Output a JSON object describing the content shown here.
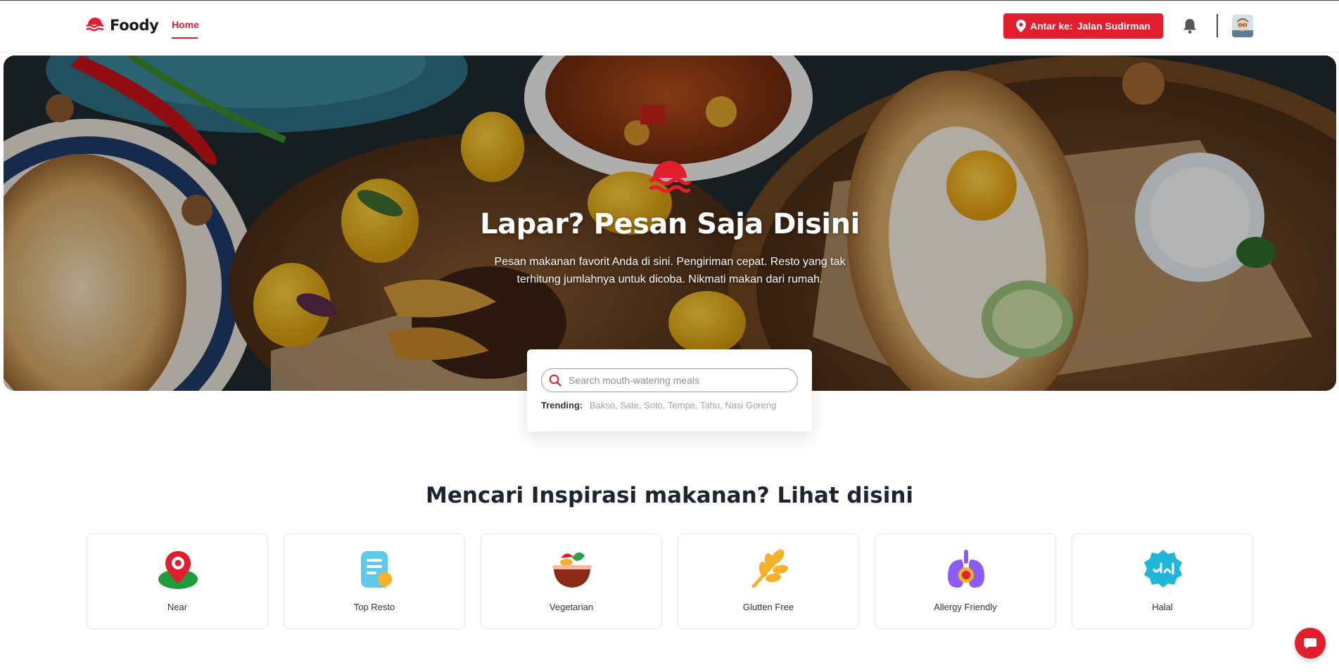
{
  "brand": {
    "name": "Foody",
    "accent": "#e11d2e"
  },
  "nav": {
    "home": "Home"
  },
  "delivery": {
    "prefix": "Antar ke:",
    "address": "Jalan Sudirman"
  },
  "hero": {
    "title": "Lapar? Pesan Saja Disini",
    "subtitle": "Pesan makanan favorit Anda di sini. Pengiriman cepat. Resto yang tak terhitung jumlahnya untuk dicoba. Nikmati makan dari rumah."
  },
  "search": {
    "placeholder": "Search mouth-watering meals",
    "trending_label": "Trending:",
    "trending_items": "Bakso, Sate, Soto, Tempe, Tahu, Nasi Goreng"
  },
  "inspiration": {
    "title": "Mencari Inspirasi makanan? Lihat disini",
    "categories": [
      {
        "label": "Near",
        "icon": "map-pin-icon"
      },
      {
        "label": "Top Resto",
        "icon": "menu-list-icon"
      },
      {
        "label": "Vegetarian",
        "icon": "salad-bowl-icon"
      },
      {
        "label": "Glutten Free",
        "icon": "wheat-icon"
      },
      {
        "label": "Allergy Friendly",
        "icon": "allergy-lungs-icon"
      },
      {
        "label": "Halal",
        "icon": "halal-badge-icon"
      }
    ]
  },
  "icons": {
    "bell": "bell-icon",
    "avatar": "avatar",
    "chat": "chat-bubble-icon",
    "location": "location-pin-icon",
    "search": "search-icon"
  }
}
